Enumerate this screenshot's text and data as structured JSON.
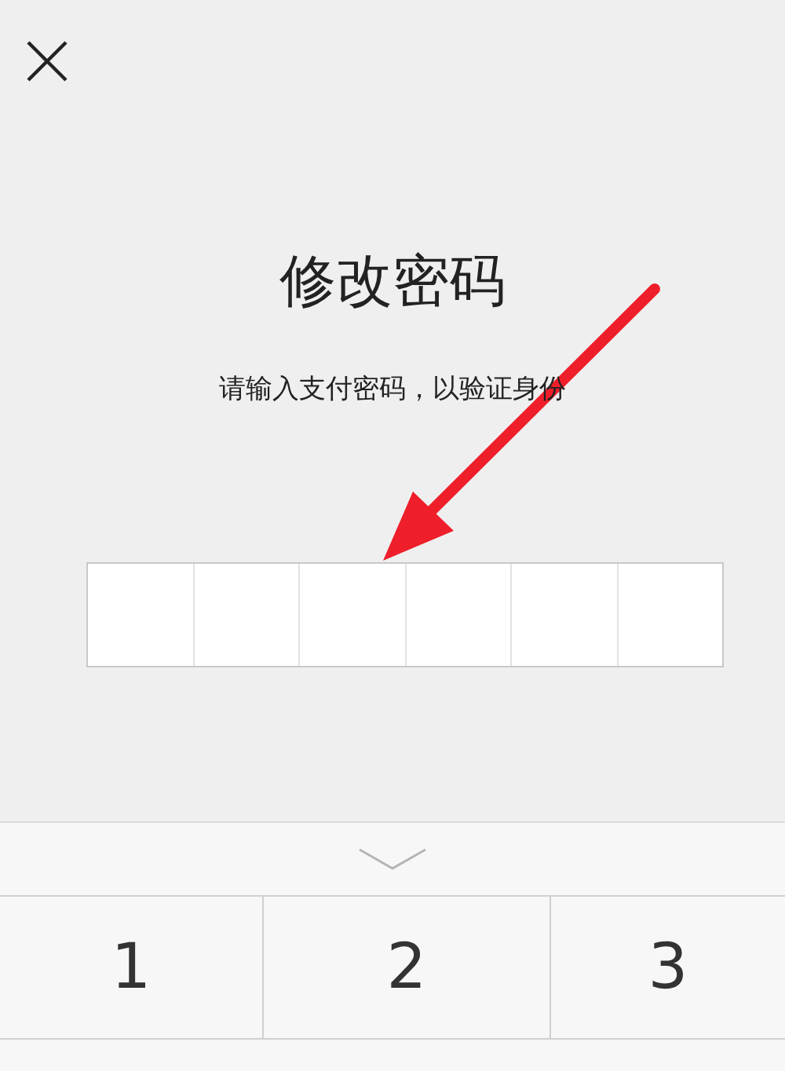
{
  "title": "修改密码",
  "subtitle": "请输入支付密码，以验证身份",
  "pin_boxes": [
    {
      "filled": false
    },
    {
      "filled": false
    },
    {
      "filled": false
    },
    {
      "filled": false
    },
    {
      "filled": false
    },
    {
      "filled": false
    }
  ],
  "keypad": {
    "keys": [
      "1",
      "2",
      "3"
    ]
  }
}
